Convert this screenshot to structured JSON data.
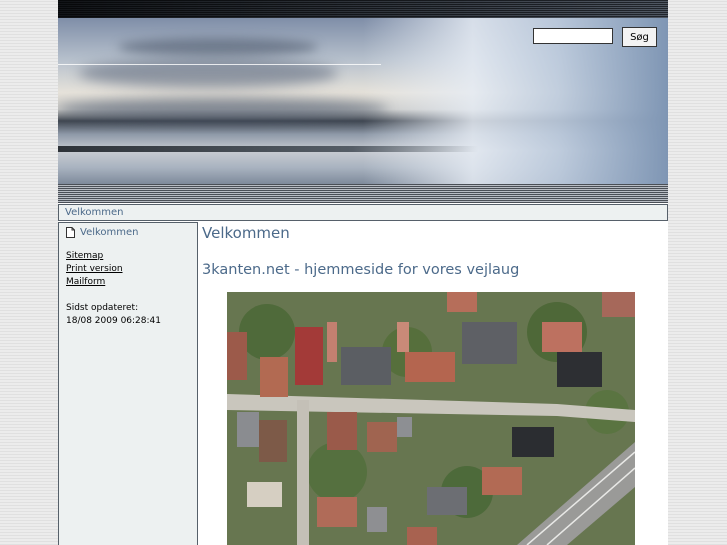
{
  "header": {
    "search": {
      "value": "",
      "button_label": "Søg"
    }
  },
  "breadcrumb": {
    "current": "Velkommen"
  },
  "sidebar": {
    "nav_item": "Velkommen",
    "links": [
      "Sitemap",
      "Print version",
      "Mailform"
    ],
    "updated_label": "Sidst opdateret:",
    "updated_value": "18/08 2009 06:28:41"
  },
  "main": {
    "title": "Velkommen",
    "subtitle": "3kanten.net - hjemmeside for vores vejlaug"
  },
  "colors": {
    "link_blue": "#4c6a8a",
    "panel_bg": "#edf1f1",
    "border": "#56606a"
  }
}
